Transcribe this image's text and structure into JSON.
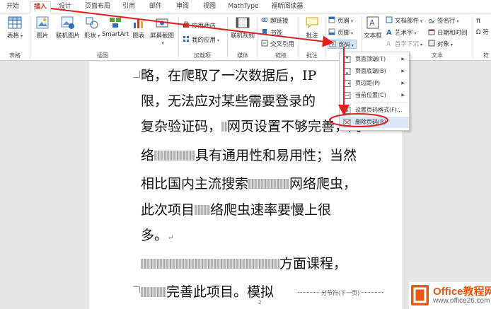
{
  "tabs": [
    {
      "label": "开始",
      "active": false
    },
    {
      "label": "插入",
      "active": true
    },
    {
      "label": "设计",
      "active": false
    },
    {
      "label": "页面布局",
      "active": false
    },
    {
      "label": "引用",
      "active": false
    },
    {
      "label": "邮件",
      "active": false
    },
    {
      "label": "审阅",
      "active": false
    },
    {
      "label": "视图",
      "active": false
    },
    {
      "label": "MathType",
      "active": false
    },
    {
      "label": "福昕阅读器",
      "active": false
    }
  ],
  "ribbon": {
    "table": "表格",
    "picture": "图片",
    "online_picture": "联机图片",
    "shapes": "形状",
    "smartart": "SmartArt",
    "chart": "图表",
    "screenshot": "屏幕截图",
    "app_store": "应用商店",
    "my_apps": "我的应用",
    "online_video": "联机视频",
    "hyperlink": "超链接",
    "bookmark": "书签",
    "cross_ref": "交叉引用",
    "comment": "批注",
    "header": "页眉",
    "footer": "页脚",
    "page_number": "页码",
    "textbox": "文本框",
    "doc_parts": "文档部件",
    "wordart": "艺术字",
    "dropcap": "首字下沉",
    "signature": "签名行",
    "datetime": "日期和时间",
    "object": "对象",
    "equation_partial": "π",
    "symbol_partial": "符",
    "groups": {
      "tables": "表格",
      "illustrations": "插图",
      "addins": "加载项",
      "media": "媒体",
      "links": "链接",
      "comments": "批注",
      "text": "文本",
      "symbols_partial": "符"
    }
  },
  "menu": {
    "items": [
      {
        "label": "页面顶端(T)",
        "submenu": true
      },
      {
        "label": "页面底端(B)",
        "submenu": true
      },
      {
        "label": "页边距(P)",
        "submenu": true
      },
      {
        "label": "当前位置(C)",
        "submenu": true
      },
      {
        "label": "设置页码格式(F)...",
        "submenu": false
      },
      {
        "label": "删除页码(R)",
        "submenu": false
      }
    ]
  },
  "document": {
    "lines": [
      {
        "pre": "略，在爬取了一次数据后，IP",
        "post": ""
      },
      {
        "pre": "限，无法应对某些需要登录的",
        "post": ""
      },
      {
        "pre": "复杂验证码，",
        "post": "网页设置不够完善，网"
      },
      {
        "pre": "络",
        "post": "具有通用性和易用性；当然"
      },
      {
        "pre": "相比国内主流搜索",
        "post": "网络爬虫，"
      },
      {
        "pre": "此次项目",
        "post": "络爬虫速率要慢上很"
      },
      {
        "pre": "多。",
        "post": ""
      },
      {
        "pre": "",
        "post": "方面课程，"
      },
      {
        "pre": "",
        "post": "完善此项目。模拟"
      }
    ],
    "section_break": "分节符(下一页)",
    "page_number": "2"
  },
  "logo": {
    "brand": "Office教程网",
    "url": "www.office26.com"
  },
  "colors": {
    "accent": "#c0392b",
    "annotation": "#e02020",
    "logo": "#e8560f"
  }
}
